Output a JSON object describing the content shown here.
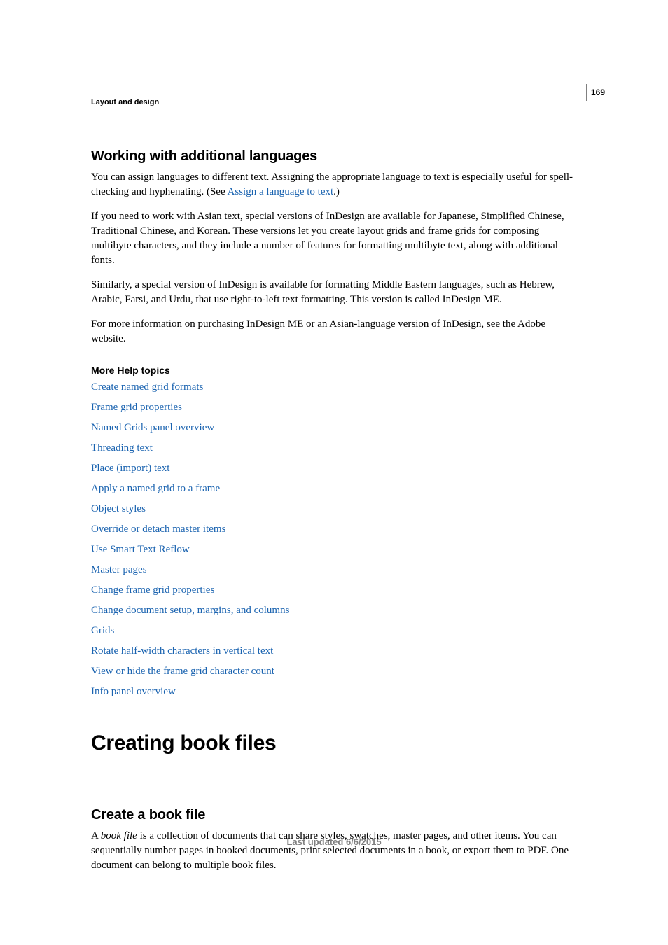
{
  "page_number": "169",
  "section_label": "Layout and design",
  "heading_languages": "Working with additional languages",
  "para1_a": "You can assign languages to different text. Assigning the appropriate language to text is especially useful for spell-checking and hyphenating. (See ",
  "para1_link": "Assign a language to text",
  "para1_b": ".)",
  "para2": "If you need to work with Asian text, special versions of InDesign are available for Japanese, Simplified Chinese, Traditional Chinese, and Korean. These versions let you create layout grids and frame grids for composing multibyte characters, and they include a number of features for formatting multibyte text, along with additional fonts.",
  "para3": "Similarly, a special version of InDesign is available for formatting Middle Eastern languages, such as Hebrew, Arabic, Farsi, and Urdu, that use right-to-left text formatting. This version is called InDesign ME.",
  "para4": "For more information on purchasing InDesign ME or an Asian-language version of InDesign, see the Adobe website.",
  "more_help_heading": "More Help topics",
  "links": {
    "l0": "Create named grid formats",
    "l1": "Frame grid properties",
    "l2": "Named Grids panel overview",
    "l3": "Threading text",
    "l4": "Place (import) text",
    "l5": "Apply a named grid to a frame",
    "l6": "Object styles",
    "l7": "Override or detach master items",
    "l8": "Use Smart Text Reflow",
    "l9": "Master pages",
    "l10": "Change frame grid properties",
    "l11": "Change document setup, margins, and columns",
    "l12": "Grids",
    "l13": "Rotate half-width characters in vertical text",
    "l14": "View or hide the frame grid character count",
    "l15": "Info panel overview"
  },
  "heading_book": "Creating book files",
  "heading_create_book": "Create a book file",
  "bookpara_a": "A ",
  "bookpara_italic": "book file",
  "bookpara_b": " is a collection of documents that can share styles, swatches, master pages, and other items. You can sequentially number pages in booked documents, print selected documents in a book, or export them to PDF. One document can belong to multiple book files.",
  "footer": "Last updated 6/6/2015"
}
